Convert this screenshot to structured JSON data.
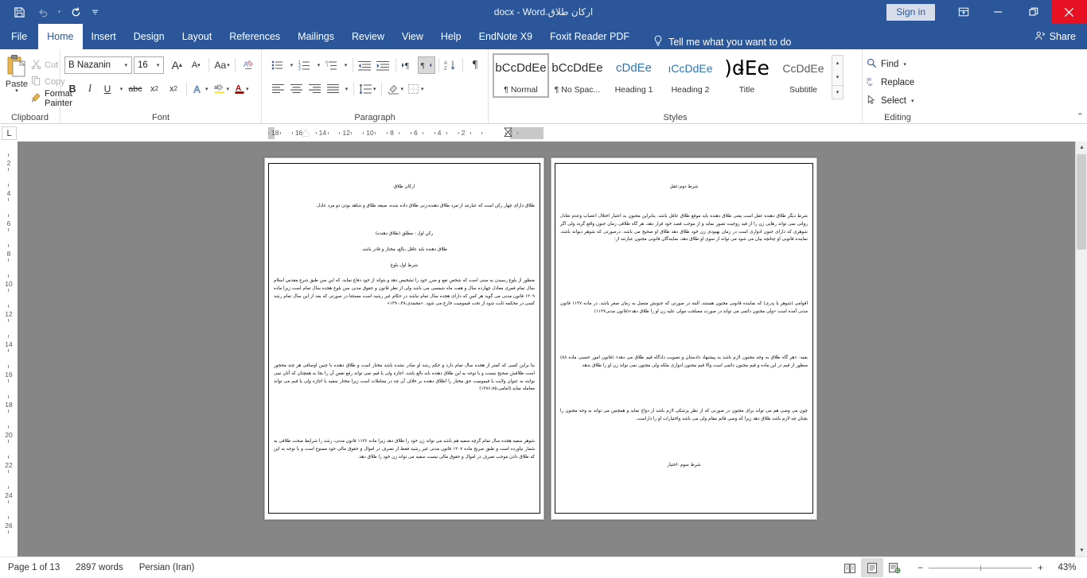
{
  "titlebar": {
    "document_title": "اركان طلاق.docx  -  Word",
    "quick_access": [
      {
        "name": "save",
        "icon": "save-icon"
      },
      {
        "name": "undo",
        "icon": "undo-icon"
      },
      {
        "name": "redo",
        "icon": "redo-icon"
      },
      {
        "name": "customize",
        "icon": "chevron-down-icon"
      }
    ],
    "sign_in": "Sign in",
    "ribbon_display_options": "ribbon-display-options-icon",
    "minimize": "minimize-icon",
    "restore": "restore-icon",
    "close": "close-icon"
  },
  "tabs": [
    {
      "label": "File",
      "active": false
    },
    {
      "label": "Home",
      "active": true
    },
    {
      "label": "Insert",
      "active": false
    },
    {
      "label": "Design",
      "active": false
    },
    {
      "label": "Layout",
      "active": false
    },
    {
      "label": "References",
      "active": false
    },
    {
      "label": "Mailings",
      "active": false
    },
    {
      "label": "Review",
      "active": false
    },
    {
      "label": "View",
      "active": false
    },
    {
      "label": "Help",
      "active": false
    },
    {
      "label": "EndNote X9",
      "active": false
    },
    {
      "label": "Foxit Reader PDF",
      "active": false
    }
  ],
  "tellme": {
    "label": "Tell me what you want to do",
    "icon": "lightbulb-icon"
  },
  "share": {
    "label": "Share",
    "icon": "person-share-icon"
  },
  "ribbon": {
    "clipboard": {
      "group_label": "Clipboard",
      "paste_label": "Paste",
      "cut_label": "Cut",
      "copy_label": "Copy",
      "format_painter_label": "Format Painter"
    },
    "font": {
      "group_label": "Font",
      "font_name": "B Nazanin",
      "font_size": "16",
      "grow_font": "A",
      "shrink_font": "A",
      "change_case": "Aa",
      "clear_formatting": "clear-formatting-icon",
      "bold": "B",
      "italic": "I",
      "underline": "U",
      "strikethrough": "abc",
      "subscript": "x",
      "superscript": "x",
      "text_effects": "A",
      "highlight": "ab",
      "font_color": "A"
    },
    "paragraph": {
      "group_label": "Paragraph",
      "bullets": "bullets-icon",
      "numbering": "numbering-icon",
      "multilevel": "multilevel-list-icon",
      "decrease_indent": "decrease-indent-icon",
      "increase_indent": "increase-indent-icon",
      "ltr_text": "left-to-right-icon",
      "rtl_text": "right-to-left-icon",
      "sort": "sort-icon",
      "show_marks": "¶",
      "align_left": "align-left-icon",
      "align_center": "align-center-icon",
      "align_right": "align-right-icon",
      "justify": "justify-icon",
      "line_spacing": "line-spacing-icon",
      "shading": "shading-icon",
      "borders": "borders-icon"
    },
    "styles": {
      "group_label": "Styles",
      "gallery": [
        {
          "sample": "bCcDdEe",
          "name": "¶ Normal",
          "selected": true,
          "kind": "normal"
        },
        {
          "sample": "bCcDdEe",
          "name": "¶ No Spac...",
          "selected": false,
          "kind": "normal"
        },
        {
          "sample": "cDdEe",
          "name": "Heading 1",
          "selected": false,
          "kind": "h1"
        },
        {
          "sample": "ıCcDdEe",
          "name": "Heading 2",
          "selected": false,
          "kind": "h2"
        },
        {
          "sample": ")d̵Ee",
          "name": "Title",
          "selected": false,
          "kind": "title"
        },
        {
          "sample": "CcDdEe",
          "name": "Subtitle",
          "selected": false,
          "kind": "sub"
        }
      ]
    },
    "editing": {
      "group_label": "Editing",
      "find": "Find",
      "replace": "Replace",
      "select": "Select"
    },
    "collapse_ribbon": "collapse-ribbon-icon"
  },
  "ruler": {
    "tab_stop_marker": "L",
    "horizontal_ticks": [
      "18",
      "16",
      "14",
      "12",
      "10",
      "8",
      "6",
      "4",
      "2",
      "",
      "2"
    ],
    "vertical_ticks": [
      "2",
      "4",
      "6",
      "8",
      "10",
      "12",
      "14",
      "16",
      "18",
      "20",
      "22",
      "24",
      "26"
    ]
  },
  "document": {
    "left_page": {
      "blocks": [
        {
          "align": "center",
          "text": "اركان طلاق"
        },
        {
          "align": "justify",
          "text": "طلاق دارای چهار ركن است كه عبارتند از:مرد طلاق دهنده،زنی طلاق داده شده، صيغه طلاق و شاهد بودن دو مرد عادل."
        },
        {
          "align": "center",
          "text": "ركن اول : مطلق (طلاق دهنده)"
        },
        {
          "align": "center",
          "text": "طلاق دهنده بايد عاقل ،بالغ، مختار و قادر باشد."
        },
        {
          "align": "center",
          "text": "شرط اول بلوغ"
        },
        {
          "align": "justify",
          "text": "منظور از بلوغ رسيدن به سنی است كه شخص نفع و ضرر خود را تشخيص دهد و بتواند از خود دفاع نمايد، كه اين سن طبق شرع مقدس اسلام سال تمام قمری معادل چهارده سال و هفت ماه شمسی می باشد ولی از نظر قانون و حقوق مدنی سن بلوغ هجده سال تمام است زيرا ماده ۱۲۰۹ قانون مدنی می گويد هر كس كه دارای هجده سال تمام نباشد در حكام غير رشيد است مستثنا در صورتی كه بعد از اين سال تمام رشد كسی در محكمه ثابت شود از تحت قيموميت خارج می شود. «محمدی،۱۳۹۰،۴۸»"
        },
        {
          "align": "justify",
          "text": "بنا براين كسی كه كمتر از هجده سال تمام دارد و حكم رشد او صادر نشده باشد مختار است و طلاق دهنده با چنين اوصافی هر چند محجور است طلاقش صحيح نيست و با توجه به اين طلاق دهنده بايد بالغ باشد. اجازه ولی يا قيم نمی تواند رفع نقص آن را بجا به همچنان كه آنان نمی توانند به عنوان ولايت يا قيموميت حق مختار را اطلاق دهنده بر خلاف آن چه در معاملات است زيرا مختار سفيه با اجازه ولی يا قيم می تواند معامله نمايد.(امامی،۱۳۸۶،۷۵)"
        },
        {
          "align": "justify",
          "text": "شوهر سفيه هجده سال تمام گرچه سفيه هم باشد می تواند زن خود را طلاق دهد زيرا ماده ۱۱۳۶ قانون مدنی، رشد را شرايط صحت طلاقی به شمار نياورده است و طبق صريح ماده ۱۲۰۷ قانون مدنی غير رشيد فقط از تصرف در اموال و حقوق مالی خود ممنوع است و با توجه به اين كه طلاق دادن موجب تصرف در اموال و حقوق مالی نيست سفيه می تواند زن خود را طلاق دهد."
        }
      ]
    },
    "right_page": {
      "blocks": [
        {
          "align": "center",
          "text": "شرط دوم:عقل"
        },
        {
          "align": "justify",
          "text": "شرط ديگر طلاق دهنده عقل است يعنی طلاق دهنده بايد موقع طلاق عاقل باشد. بنابراين مجنون به اعتبار اختلال اعصاب وعدم تعادل روانی نمی تواند رهايی زن را از قيد زوجيت تصور نمايد و از موجب قصد خود قرار دهد، هر گاه طلاقی زمان جنون واقع گردد ولی اگر شوهری كه دارای جنون ادواری است در زمان بهبودی زن خود طلاق دهد طلاق او صحيح می باشد. درصورتی كه شوهر ديوانه باشد، نماينده قانونی او چنانچه بيان می شود می تواند از سوی او طلاق دهد، نمايندگان قانونی مجنون عبارتند از:"
        },
        {
          "align": "justify",
          "text": "اقوامی (شوهر يا پدری) كه نماينده قانونی مجنون هستند، البته در صورتی كه جنونش متصل به زمان صغر باشد. در ماده ۱۱۳۷ قانون مدنی آمده است «ولی مجنون دائمی می تواند در صورت مصلحت مولی عليه زن او را طلاق دهد»(قانون مدنی۱۱۳۷)"
        },
        {
          "align": "justify",
          "text": "بقيه: «هر گاه طلاق به وجه مجنون لازم باشد به پيشنهاد دادستان و تصويب دادگاه قيم طلاق می دهد» (قانون امور حسبی ماده ۸۸) منظور از قيم در اين ماده و قيم مجنون دائمی است والا قيم مجنون ادواری ملكه ولی مجنون نمی تواند زن او را طلاق بدهد."
        },
        {
          "align": "justify",
          "text": "چون می وصی هم می تواند برای مجنون در صورتی كه از نظر پزشكی لازم باشد از دواج نمايد و همچنين می تواند به وجه مجنون را بچنان چه لازم باشد طلاق دهد زيرا كه وصی قائم مقام ولی می باشد واختيارات او را داراست."
        },
        {
          "align": "center",
          "text": "شرط سوم :اختيار"
        }
      ]
    }
  },
  "statusbar": {
    "page_info": "Page 1 of 13",
    "word_count": "2897 words",
    "language": "Persian (Iran)",
    "views": [
      {
        "name": "read-mode",
        "selected": false
      },
      {
        "name": "print-layout",
        "selected": true
      },
      {
        "name": "web-layout",
        "selected": false
      }
    ],
    "zoom_out": "−",
    "zoom_in": "+",
    "zoom_level": "43%"
  }
}
